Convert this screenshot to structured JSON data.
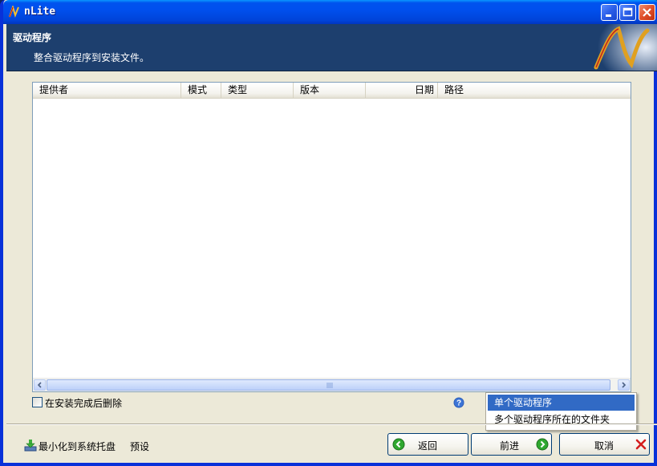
{
  "window": {
    "title": "nLite"
  },
  "header": {
    "title": "驱动程序",
    "subtitle": "整合驱动程序到安装文件。"
  },
  "list": {
    "columns": [
      "提供者",
      "模式",
      "类型",
      "版本",
      "日期",
      "路径"
    ],
    "rows": []
  },
  "options": {
    "delete_after_install_label": "在安装完成后删除",
    "delete_after_install_checked": false
  },
  "popup_menu": {
    "items": [
      "单个驱动程序",
      "多个驱动程序所在的文件夹"
    ],
    "selected_index": 0
  },
  "footer": {
    "minimize_to_tray_label": "最小化到系统托盘",
    "presets_label": "预设",
    "back_label": "返回",
    "next_label": "前进",
    "cancel_label": "取消"
  },
  "icons": {
    "app": "nlite-logo-icon",
    "help": "question-icon",
    "back": "green-left-arrow-icon",
    "next": "green-right-arrow-icon",
    "cancel": "red-x-icon",
    "tray": "download-tray-icon"
  },
  "colors": {
    "titlebar": "#0054e3",
    "header_band": "#1d3f6e",
    "selection": "#316ac5",
    "window_face": "#ece9d8"
  }
}
